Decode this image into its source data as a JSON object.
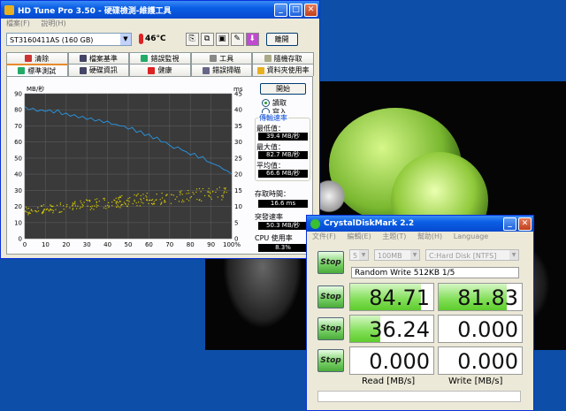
{
  "hdtune": {
    "title": "HD Tune Pro 3.50 - 硬碟檢測-維護工具",
    "menu": [
      "檔案(F)",
      "說明(H)"
    ],
    "drive": "ST3160411AS (160 GB)",
    "temperature": "46",
    "temp_unit": "°C",
    "exit_label": "離開",
    "tabs_row1": [
      "清除",
      "檔案基準",
      "錯誤監視",
      "工具",
      "隨機存取"
    ],
    "tabs_row2": [
      "標準測試",
      "硬碟資訊",
      "健康",
      "錯誤掃瞄",
      "資料夾使用率"
    ],
    "start_label": "開始",
    "radio_read": "讀取",
    "radio_write": "寫入",
    "group_title": "傳輸速率",
    "min_label": "最低值：",
    "min_value": "39.4 MB/秒",
    "max_label": "最大值：",
    "max_value": "82.7 MB/秒",
    "avg_label": "平均值：",
    "avg_value": "66.6 MB/秒",
    "access_label": "存取時間：",
    "access_value": "16.6 ms",
    "burst_label": "突發速率",
    "burst_value": "50.3 MB/秒",
    "cpu_label": "CPU 使用率",
    "cpu_value": "8.3%"
  },
  "chart_data": {
    "type": "line",
    "y_left_label": "MB/秒",
    "y_right_label": "ms",
    "x_ticks": [
      "0",
      "10",
      "20",
      "30",
      "40",
      "50",
      "60",
      "70",
      "80",
      "90",
      "100%"
    ],
    "y_left_ticks": [
      "0",
      "10",
      "20",
      "30",
      "40",
      "50",
      "60",
      "70",
      "80",
      "90"
    ],
    "y_right_ticks": [
      "0",
      "5",
      "10",
      "15",
      "20",
      "25",
      "30",
      "35",
      "40",
      "45"
    ],
    "ylim": [
      0,
      90
    ],
    "y2lim": [
      0,
      45
    ],
    "series": [
      {
        "kind": "transfer",
        "color": "#2a8fd6",
        "x": [
          0,
          2,
          4,
          6,
          8,
          10,
          12,
          14,
          16,
          18,
          20,
          22,
          24,
          26,
          28,
          30,
          32,
          34,
          36,
          38,
          40,
          42,
          44,
          46,
          48,
          50,
          52,
          54,
          56,
          58,
          60,
          62,
          64,
          66,
          68,
          70,
          72,
          74,
          76,
          78,
          80,
          82,
          84,
          86,
          88,
          90,
          92,
          94,
          96,
          98,
          100
        ],
        "y": [
          82,
          80,
          81,
          79,
          80,
          79,
          80,
          78,
          80,
          77,
          78,
          76,
          77,
          75,
          76,
          74,
          75,
          73,
          74,
          72,
          73,
          71,
          71,
          70,
          70,
          68,
          69,
          66,
          67,
          64,
          65,
          62,
          63,
          60,
          60,
          58,
          56,
          57,
          55,
          54,
          52,
          53,
          50,
          51,
          48,
          47,
          46,
          45,
          43,
          42,
          40
        ]
      },
      {
        "kind": "access",
        "color": "#d4c800",
        "band": [
          [
            0,
            15,
            20
          ],
          [
            20,
            17,
            23
          ],
          [
            40,
            19,
            26
          ],
          [
            60,
            21,
            29
          ],
          [
            80,
            23,
            31
          ],
          [
            100,
            25,
            33
          ]
        ]
      }
    ]
  },
  "cdm": {
    "title": "CrystalDiskMark 2.2",
    "menu": [
      "文件(F)",
      "編輯(E)",
      "主題(T)",
      "幫助(H)",
      "Language"
    ],
    "count": "5",
    "size": "100MB",
    "drive": "C:Hard Disk [NTFS]",
    "status_title": "Random Write 512KB 1/5",
    "stop_label": "Stop",
    "rows": [
      {
        "read": "84.71",
        "write": "81.83",
        "read_fill": 0.85,
        "write_fill": 0.82
      },
      {
        "read": "36.24",
        "write": "0.000",
        "read_fill": 0.36,
        "write_fill": 0
      },
      {
        "read": "0.000",
        "write": "0.000",
        "read_fill": 0,
        "write_fill": 0
      }
    ],
    "read_label": "Read [MB/s]",
    "write_label": "Write [MB/s]"
  }
}
